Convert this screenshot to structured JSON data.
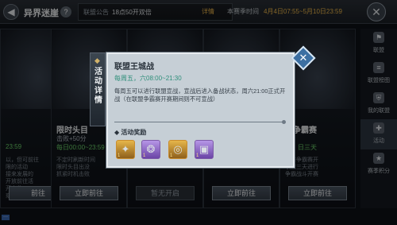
{
  "topbar": {
    "back_icon": "hexagon-back-icon",
    "title": "异界迷崖",
    "help_label": "?",
    "notice_label": "联盟公告",
    "notice_text": "18点50开双倍",
    "detail_link": "详情",
    "season_label": "本赛季时间",
    "season_value": "4月4日07:55~5月10日23:59",
    "close_label": "✕"
  },
  "cards": [
    {
      "name": "",
      "sub1": "",
      "sub2": "23:59",
      "desc": "以，但可前往\n限的活动\n接来发展的\n开放前往活\n开启收\n或达成任务奖",
      "button": "前往",
      "disabled": false
    },
    {
      "name": "限时头目",
      "sub1": "击败+50分",
      "sub2": "每日00:00~23:59",
      "desc": "不定时刷新时间\n限时头目出没\n抓紧时机击败",
      "button": "立即前往",
      "disabled": false
    },
    {
      "name": "",
      "sub1": "",
      "sub2": "",
      "desc": "",
      "button": "暂无开启",
      "disabled": true
    },
    {
      "name": "",
      "sub1": "",
      "sub2": "",
      "desc": "",
      "button": "立即前往",
      "disabled": false
    },
    {
      "name": "霸争霸赛",
      "sub1": "",
      "sub2": "六、日三天",
      "desc": "赛季争霸赛开\n联盟三天进行\n争霸战斗开赛",
      "button": "立即前往",
      "disabled": false
    }
  ],
  "rightnav": [
    {
      "icon": "alliance-icon",
      "label": "联盟",
      "active": false
    },
    {
      "icon": "ranking-icon",
      "label": "联盟榜图",
      "active": false
    },
    {
      "icon": "shield-icon",
      "label": "我的联盟",
      "active": false
    },
    {
      "icon": "activity-icon",
      "label": "活动",
      "active": true
    },
    {
      "icon": "points-icon",
      "label": "赛季积分",
      "active": false
    }
  ],
  "modal": {
    "tab_glyph": "◆",
    "tab_label": "活动详情",
    "title": "联盟王城战",
    "time": "每周五，六08:00~21:30",
    "description": "每周五可以进行联盟宣战，宣战后进入备战状态，周六21:00正式开战（在联盟争霸赛开赛期间则不可宣战）",
    "reward_title": "◆ 活动奖励",
    "close_icon": "close-x-icon",
    "rewards": [
      {
        "icon": "gold-crystal-icon",
        "glyph": "✦",
        "level": "1",
        "style": "gold"
      },
      {
        "icon": "silver-dragon-icon",
        "glyph": "❂",
        "level": "1",
        "style": "purple"
      },
      {
        "icon": "gold-medal-icon",
        "glyph": "◎",
        "level": "1",
        "style": "gold"
      },
      {
        "icon": "treasure-chest-icon",
        "glyph": "▣",
        "level": "1",
        "style": "purple"
      }
    ]
  },
  "footer": {
    "dots": "···"
  }
}
